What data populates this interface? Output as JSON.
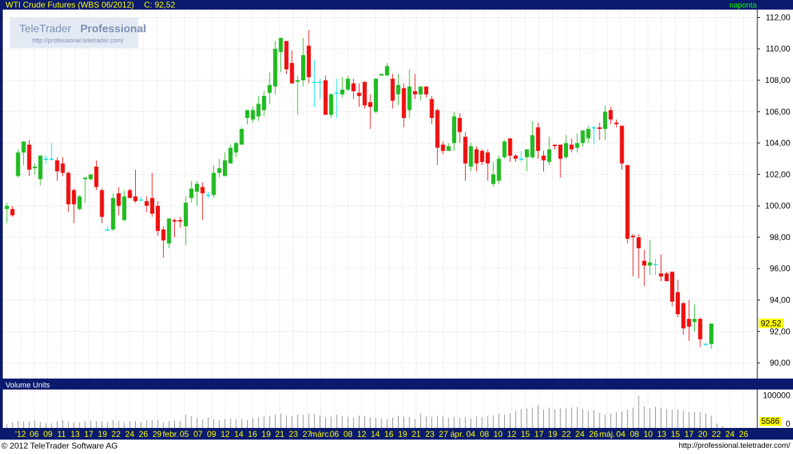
{
  "chart_data": [
    {
      "type": "candlestick",
      "title": "WTI Crude Futures (WBS 06/2012)",
      "last_label": "C:",
      "last_value": "92,52",
      "period": "naponta",
      "watermark": {
        "brand1": "TeleTrader",
        "brand2": "Professional",
        "url": "http://professional.teletrader.com/"
      },
      "ylim": [
        89,
        112.5
      ],
      "yticks": [
        "90,00",
        "92,00",
        "94,00",
        "96,00",
        "98,00",
        "100,00",
        "102,00",
        "104,00",
        "106,00",
        "108,00",
        "110,00",
        "112,00"
      ],
      "price_badge": "92,52",
      "grid": true,
      "x_labels": [
        "'12",
        "06",
        "09",
        "11",
        "13",
        "17",
        "19",
        "22",
        "24",
        "26",
        "29",
        "febr.",
        "05",
        "07",
        "09",
        "12",
        "14",
        "16",
        "19",
        "21",
        "23",
        "27",
        "márc.",
        "06",
        "08",
        "12",
        "14",
        "16",
        "19",
        "21",
        "23",
        "27",
        "ápr.",
        "04",
        "08",
        "10",
        "12",
        "15",
        "17",
        "19",
        "22",
        "24",
        "26",
        "máj.",
        "04",
        "08",
        "10",
        "13",
        "15",
        "17",
        "20",
        "22",
        "24",
        "26"
      ],
      "candles": [
        {
          "o": 99.8,
          "h": 100.2,
          "l": 98.9,
          "c": 100.0
        },
        {
          "o": 99.8,
          "h": 100.0,
          "l": 99.3,
          "c": 99.4
        },
        {
          "o": 101.9,
          "h": 103.6,
          "l": 101.8,
          "c": 103.4
        },
        {
          "o": 103.4,
          "h": 104.1,
          "l": 102.6,
          "c": 104.1
        },
        {
          "o": 103.9,
          "h": 104.2,
          "l": 101.9,
          "c": 102.3
        },
        {
          "o": 102.4,
          "h": 102.7,
          "l": 102.0,
          "c": 102.5
        },
        {
          "o": 101.7,
          "h": 103.2,
          "l": 101.3,
          "c": 103.2
        },
        {
          "o": 103.0,
          "h": 103.2,
          "l": 102.7,
          "c": 103.0
        },
        {
          "o": 103.0,
          "h": 104.0,
          "l": 102.9,
          "c": 103.0
        },
        {
          "o": 102.9,
          "h": 103.1,
          "l": 101.6,
          "c": 102.2
        },
        {
          "o": 102.7,
          "h": 103.1,
          "l": 101.9,
          "c": 102.1
        },
        {
          "o": 102.1,
          "h": 102.2,
          "l": 99.6,
          "c": 100.1
        },
        {
          "o": 101.0,
          "h": 101.1,
          "l": 98.9,
          "c": 100.1
        },
        {
          "o": 99.8,
          "h": 100.7,
          "l": 99.7,
          "c": 100.6
        },
        {
          "o": 101.7,
          "h": 101.8,
          "l": 100.2,
          "c": 101.8
        },
        {
          "o": 101.7,
          "h": 102.0,
          "l": 101.6,
          "c": 102.0
        },
        {
          "o": 102.5,
          "h": 102.9,
          "l": 101.0,
          "c": 101.2
        },
        {
          "o": 101.0,
          "h": 101.1,
          "l": 98.9,
          "c": 99.3
        },
        {
          "o": 98.5,
          "h": 98.7,
          "l": 98.4,
          "c": 98.5
        },
        {
          "o": 98.5,
          "h": 100.8,
          "l": 98.4,
          "c": 100.5
        },
        {
          "o": 100.8,
          "h": 101.2,
          "l": 99.4,
          "c": 100.0
        },
        {
          "o": 99.1,
          "h": 101.0,
          "l": 99.0,
          "c": 100.6
        },
        {
          "o": 101.0,
          "h": 101.1,
          "l": 100.5,
          "c": 100.5
        },
        {
          "o": 100.6,
          "h": 102.3,
          "l": 100.2,
          "c": 100.3
        },
        {
          "o": 100.4,
          "h": 100.6,
          "l": 100.3,
          "c": 100.4
        },
        {
          "o": 100.3,
          "h": 100.6,
          "l": 99.6,
          "c": 100.0
        },
        {
          "o": 100.5,
          "h": 102.1,
          "l": 99.3,
          "c": 99.5
        },
        {
          "o": 100.0,
          "h": 100.3,
          "l": 98.1,
          "c": 98.4
        },
        {
          "o": 98.5,
          "h": 98.7,
          "l": 96.7,
          "c": 97.8
        },
        {
          "o": 97.6,
          "h": 99.2,
          "l": 97.3,
          "c": 99.2
        },
        {
          "o": 99.1,
          "h": 99.2,
          "l": 98.0,
          "c": 99.0
        },
        {
          "o": 99.1,
          "h": 99.3,
          "l": 98.6,
          "c": 99.0
        },
        {
          "o": 98.7,
          "h": 100.6,
          "l": 97.5,
          "c": 100.2
        },
        {
          "o": 100.5,
          "h": 101.6,
          "l": 100.2,
          "c": 101.1
        },
        {
          "o": 100.9,
          "h": 101.6,
          "l": 100.0,
          "c": 101.4
        },
        {
          "o": 101.2,
          "h": 101.5,
          "l": 99.1,
          "c": 100.8
        },
        {
          "o": 100.7,
          "h": 100.9,
          "l": 100.5,
          "c": 100.7
        },
        {
          "o": 100.7,
          "h": 102.6,
          "l": 100.5,
          "c": 102.1
        },
        {
          "o": 102.1,
          "h": 103.0,
          "l": 101.8,
          "c": 102.4
        },
        {
          "o": 101.9,
          "h": 103.4,
          "l": 101.9,
          "c": 102.9
        },
        {
          "o": 102.7,
          "h": 103.9,
          "l": 102.7,
          "c": 103.7
        },
        {
          "o": 103.4,
          "h": 104.1,
          "l": 103.1,
          "c": 104.0
        },
        {
          "o": 103.9,
          "h": 105.0,
          "l": 103.9,
          "c": 104.9
        },
        {
          "o": 105.6,
          "h": 106.1,
          "l": 105.2,
          "c": 106.1
        },
        {
          "o": 105.5,
          "h": 106.3,
          "l": 105.3,
          "c": 106.1
        },
        {
          "o": 105.7,
          "h": 107.0,
          "l": 105.4,
          "c": 106.5
        },
        {
          "o": 106.1,
          "h": 107.3,
          "l": 105.7,
          "c": 107.0
        },
        {
          "o": 107.2,
          "h": 108.5,
          "l": 106.5,
          "c": 107.7
        },
        {
          "o": 107.6,
          "h": 110.5,
          "l": 107.1,
          "c": 110.0
        },
        {
          "o": 109.8,
          "h": 110.7,
          "l": 108.5,
          "c": 110.7
        },
        {
          "o": 110.5,
          "h": 110.5,
          "l": 108.4,
          "c": 108.7
        },
        {
          "o": 109.1,
          "h": 109.9,
          "l": 107.8,
          "c": 107.8
        },
        {
          "o": 107.9,
          "h": 108.3,
          "l": 105.8,
          "c": 108.0
        },
        {
          "o": 108.0,
          "h": 110.7,
          "l": 107.6,
          "c": 109.6
        },
        {
          "o": 110.2,
          "h": 111.2,
          "l": 107.8,
          "c": 108.2
        },
        {
          "o": 107.9,
          "h": 109.3,
          "l": 106.3,
          "c": 107.9
        },
        {
          "o": 107.9,
          "h": 108.1,
          "l": 106.8,
          "c": 107.9
        },
        {
          "o": 108.0,
          "h": 108.3,
          "l": 105.8,
          "c": 105.8
        },
        {
          "o": 105.8,
          "h": 107.2,
          "l": 105.6,
          "c": 107.1
        },
        {
          "o": 107.2,
          "h": 108.1,
          "l": 105.6,
          "c": 107.2
        },
        {
          "o": 107.1,
          "h": 108.2,
          "l": 106.9,
          "c": 107.4
        },
        {
          "o": 107.4,
          "h": 108.3,
          "l": 107.3,
          "c": 108.1
        },
        {
          "o": 107.8,
          "h": 108.1,
          "l": 106.8,
          "c": 107.3
        },
        {
          "o": 107.2,
          "h": 107.8,
          "l": 106.3,
          "c": 107.0
        },
        {
          "o": 107.9,
          "h": 107.9,
          "l": 106.2,
          "c": 106.4
        },
        {
          "o": 106.6,
          "h": 107.1,
          "l": 104.9,
          "c": 106.3
        },
        {
          "o": 106.0,
          "h": 108.1,
          "l": 105.9,
          "c": 108.1
        },
        {
          "o": 108.3,
          "h": 108.4,
          "l": 108.3,
          "c": 108.4
        },
        {
          "o": 108.3,
          "h": 109.1,
          "l": 108.3,
          "c": 108.9
        },
        {
          "o": 108.1,
          "h": 108.4,
          "l": 106.2,
          "c": 106.7
        },
        {
          "o": 107.1,
          "h": 108.4,
          "l": 106.4,
          "c": 107.7
        },
        {
          "o": 107.5,
          "h": 107.8,
          "l": 105.0,
          "c": 105.6
        },
        {
          "o": 106.1,
          "h": 108.7,
          "l": 105.6,
          "c": 107.6
        },
        {
          "o": 107.3,
          "h": 108.4,
          "l": 106.8,
          "c": 107.1
        },
        {
          "o": 107.1,
          "h": 107.6,
          "l": 106.7,
          "c": 107.6
        },
        {
          "o": 107.6,
          "h": 107.6,
          "l": 106.9,
          "c": 107.1
        },
        {
          "o": 106.8,
          "h": 107.0,
          "l": 105.2,
          "c": 105.6
        },
        {
          "o": 106.1,
          "h": 106.2,
          "l": 102.6,
          "c": 103.7
        },
        {
          "o": 103.9,
          "h": 104.1,
          "l": 103.3,
          "c": 103.5
        },
        {
          "o": 103.5,
          "h": 104.0,
          "l": 103.5,
          "c": 103.8
        },
        {
          "o": 104.0,
          "h": 106.0,
          "l": 103.5,
          "c": 105.7
        },
        {
          "o": 105.6,
          "h": 105.9,
          "l": 104.0,
          "c": 104.7
        },
        {
          "o": 104.4,
          "h": 104.7,
          "l": 101.6,
          "c": 102.7
        },
        {
          "o": 102.5,
          "h": 104.0,
          "l": 102.2,
          "c": 103.8
        },
        {
          "o": 103.6,
          "h": 103.8,
          "l": 102.2,
          "c": 102.7
        },
        {
          "o": 103.5,
          "h": 103.6,
          "l": 102.6,
          "c": 102.8
        },
        {
          "o": 103.4,
          "h": 103.6,
          "l": 101.6,
          "c": 102.7
        },
        {
          "o": 101.4,
          "h": 102.8,
          "l": 101.2,
          "c": 102.0
        },
        {
          "o": 101.6,
          "h": 103.2,
          "l": 101.4,
          "c": 103.0
        },
        {
          "o": 103.1,
          "h": 104.2,
          "l": 103.0,
          "c": 104.1
        },
        {
          "o": 104.3,
          "h": 104.3,
          "l": 102.8,
          "c": 103.2
        },
        {
          "o": 103.2,
          "h": 103.3,
          "l": 102.8,
          "c": 103.0
        },
        {
          "o": 103.0,
          "h": 103.5,
          "l": 102.8,
          "c": 103.0
        },
        {
          "o": 103.1,
          "h": 103.6,
          "l": 102.2,
          "c": 103.6
        },
        {
          "o": 103.1,
          "h": 105.4,
          "l": 103.0,
          "c": 104.5
        },
        {
          "o": 105.0,
          "h": 105.3,
          "l": 103.0,
          "c": 103.5
        },
        {
          "o": 103.2,
          "h": 103.5,
          "l": 102.2,
          "c": 102.9
        },
        {
          "o": 102.8,
          "h": 104.4,
          "l": 102.6,
          "c": 103.6
        },
        {
          "o": 103.9,
          "h": 103.9,
          "l": 103.6,
          "c": 103.8
        },
        {
          "o": 103.9,
          "h": 103.9,
          "l": 101.8,
          "c": 103.0
        },
        {
          "o": 103.1,
          "h": 104.5,
          "l": 103.0,
          "c": 104.0
        },
        {
          "o": 103.9,
          "h": 104.3,
          "l": 103.4,
          "c": 103.6
        },
        {
          "o": 103.7,
          "h": 104.6,
          "l": 103.4,
          "c": 104.0
        },
        {
          "o": 104.0,
          "h": 104.8,
          "l": 103.8,
          "c": 104.8
        },
        {
          "o": 104.3,
          "h": 105.1,
          "l": 104.0,
          "c": 104.9
        },
        {
          "o": 105.0,
          "h": 105.1,
          "l": 103.9,
          "c": 105.0
        },
        {
          "o": 105.0,
          "h": 105.3,
          "l": 104.2,
          "c": 104.9
        },
        {
          "o": 104.9,
          "h": 106.4,
          "l": 104.2,
          "c": 106.0
        },
        {
          "o": 106.1,
          "h": 106.3,
          "l": 105.2,
          "c": 105.5
        },
        {
          "o": 105.3,
          "h": 105.5,
          "l": 105.0,
          "c": 105.2
        },
        {
          "o": 105.1,
          "h": 105.1,
          "l": 102.3,
          "c": 102.7
        },
        {
          "o": 102.6,
          "h": 102.6,
          "l": 97.6,
          "c": 97.9
        },
        {
          "o": 98.1,
          "h": 98.2,
          "l": 95.5,
          "c": 98.0
        },
        {
          "o": 98.0,
          "h": 98.2,
          "l": 95.4,
          "c": 97.3
        },
        {
          "o": 96.5,
          "h": 97.2,
          "l": 94.9,
          "c": 96.2
        },
        {
          "o": 96.2,
          "h": 97.8,
          "l": 95.6,
          "c": 96.4
        },
        {
          "o": 96.3,
          "h": 96.6,
          "l": 95.6,
          "c": 96.3
        },
        {
          "o": 95.7,
          "h": 96.9,
          "l": 95.2,
          "c": 95.5
        },
        {
          "o": 95.7,
          "h": 95.8,
          "l": 95.2,
          "c": 95.2
        },
        {
          "o": 95.8,
          "h": 95.8,
          "l": 93.6,
          "c": 93.9
        },
        {
          "o": 94.5,
          "h": 95.3,
          "l": 92.9,
          "c": 93.1
        },
        {
          "o": 93.8,
          "h": 93.9,
          "l": 91.8,
          "c": 92.2
        },
        {
          "o": 92.8,
          "h": 94.0,
          "l": 91.4,
          "c": 92.3
        },
        {
          "o": 92.6,
          "h": 93.7,
          "l": 92.0,
          "c": 92.8
        },
        {
          "o": 92.8,
          "h": 92.9,
          "l": 91.0,
          "c": 91.5
        },
        {
          "o": 91.2,
          "h": 91.3,
          "l": 91.1,
          "c": 91.2
        },
        {
          "o": 91.2,
          "h": 92.5,
          "l": 90.9,
          "c": 92.5
        }
      ]
    },
    {
      "type": "bar",
      "title": "Volume Units",
      "yticks": [
        "100000",
        "0"
      ],
      "badge": "5586",
      "ylim": [
        0,
        110000
      ],
      "values": [
        12000,
        17000,
        22000,
        20000,
        21000,
        23000,
        19000,
        15000,
        14000,
        21000,
        24000,
        20000,
        17000,
        18000,
        22000,
        23000,
        21000,
        20000,
        18000,
        24000,
        22000,
        17000,
        20000,
        22000,
        18000,
        23000,
        24000,
        25000,
        17000,
        21000,
        24000,
        22000,
        42000,
        36000,
        31000,
        26000,
        33000,
        28000,
        24000,
        27000,
        29000,
        27000,
        28000,
        25000,
        31000,
        33000,
        36000,
        38000,
        41000,
        45000,
        39000,
        37000,
        42000,
        40000,
        43000,
        44000,
        39000,
        33000,
        35000,
        41000,
        36000,
        34000,
        32000,
        38000,
        37000,
        33000,
        31000,
        29000,
        27000,
        32000,
        38000,
        35000,
        33000,
        28000,
        45000,
        36000,
        34000,
        38000,
        35000,
        31000,
        34000,
        31000,
        33000,
        29000,
        35000,
        34000,
        37000,
        39000,
        43000,
        41000,
        45000,
        52000,
        58000,
        60000,
        63000,
        71000,
        56000,
        63000,
        58000,
        61000,
        59000,
        63000,
        65000,
        58000,
        52000,
        54000,
        47000,
        41000,
        45000,
        49000,
        51000,
        56000,
        63000,
        100000,
        67000,
        62000,
        65000,
        63000,
        59000,
        56000,
        57000,
        53000,
        50000,
        49000,
        48000,
        44000,
        38000,
        14000,
        6000
      ]
    }
  ],
  "footer": {
    "copyright": "© 2012 TeleTrader Software AG",
    "url": "http://professional.teletrader.com/"
  },
  "colors": {
    "up": "#22bb22",
    "down": "#ee1111",
    "neutral": "#00e0e0",
    "frame": "#0a1b6e",
    "header_text": "#ffff00",
    "period_text": "#00ff00",
    "grid": "#b0b0b0",
    "volume": "#888888",
    "badge": "#ffff00"
  }
}
